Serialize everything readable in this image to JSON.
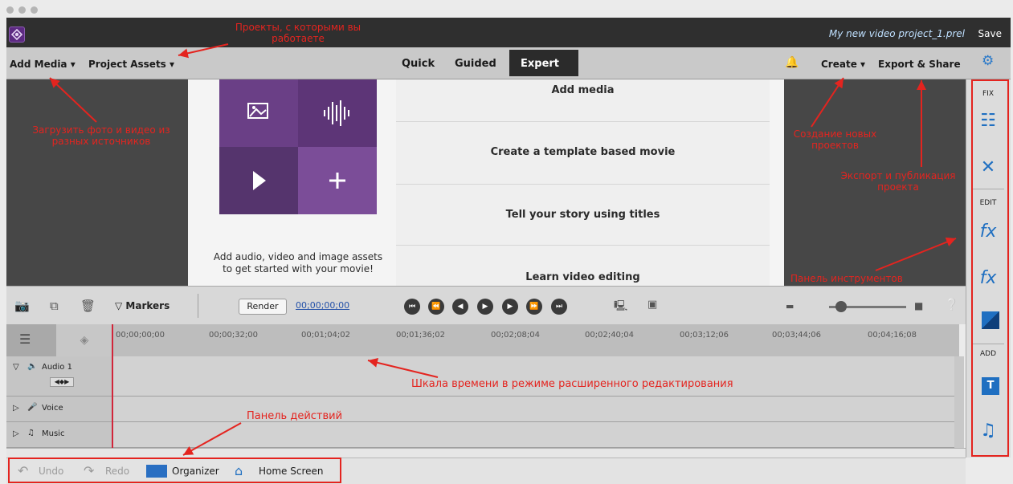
{
  "window": {
    "project_name": "My new video project_1.prel",
    "save_label": "Save"
  },
  "menubar": {
    "add_media": "Add Media ▾",
    "project_assets": "Project Assets ▾",
    "tabs": [
      "Quick",
      "Guided",
      "Expert"
    ],
    "create": "Create ▾",
    "export_share": "Export & Share"
  },
  "center": {
    "caption": "Add audio, video and image assets to get started with your movie!",
    "options": [
      "Add media",
      "Create a template based movie",
      "Tell your story using titles",
      "Learn video editing"
    ]
  },
  "toolbar": {
    "markers": "Markers",
    "render": "Render",
    "timecode": "00;00;00;00"
  },
  "ruler": {
    "ticks": [
      "00;00;00;00",
      "00;00;32;00",
      "00;01;04;02",
      "00;01;36;02",
      "00;02;08;04",
      "00;02;40;04",
      "00;03;12;06",
      "00;03;44;06",
      "00;04;16;08"
    ]
  },
  "tracks": [
    {
      "name": "Audio 1"
    },
    {
      "name": "Voice"
    },
    {
      "name": "Music"
    }
  ],
  "actions": {
    "undo": "Undo",
    "redo": "Redo",
    "organizer": "Organizer",
    "home_screen": "Home Screen"
  },
  "tool_panel": {
    "fix": "FIX",
    "edit": "EDIT",
    "add": "ADD"
  },
  "annotations": {
    "projects": "Проекты, с которыми вы работаете",
    "upload": "Загрузить фото и видео из разных источников",
    "create_new": "Создание новых проектов",
    "export": "Экспорт и публикация проекта",
    "tools": "Панель инструментов",
    "timeline": "Шкала времени в режиме расширенного редактирования",
    "actions": "Панель действий"
  },
  "colors": {
    "accent": "#1f6fc1",
    "annotation": "#e4241f",
    "tile_purple": "#7b4d98"
  }
}
